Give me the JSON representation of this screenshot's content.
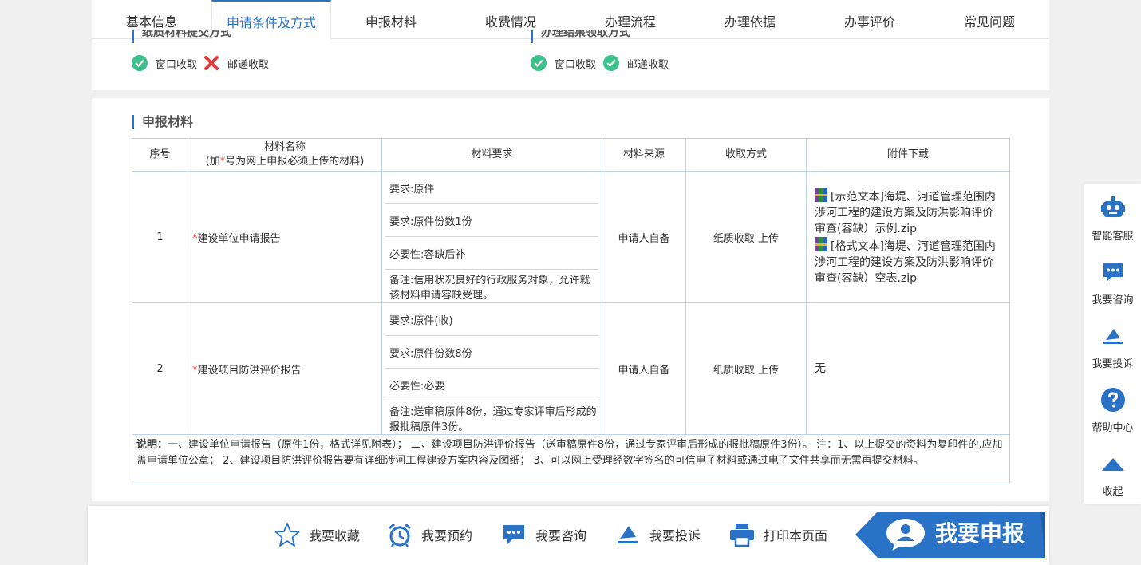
{
  "tabs": [
    "基本信息",
    "申请条件及方式",
    "申报材料",
    "收费情况",
    "办理流程",
    "办理依据",
    "办事评价",
    "常见问题"
  ],
  "active_tab": "申请条件及方式",
  "submit_section": {
    "heading": "纸质材料提交方式",
    "options": [
      {
        "label": "窗口收取",
        "status": "check"
      },
      {
        "label": "邮递收取",
        "status": "cross"
      }
    ]
  },
  "result_section": {
    "heading": "办理结果领取方式",
    "options": [
      {
        "label": "窗口收取",
        "status": "check"
      },
      {
        "label": "邮递收取",
        "status": "check"
      }
    ]
  },
  "materials": {
    "title": "申报材料",
    "headers": {
      "index": "序号",
      "name_line1": "材料名称",
      "name_line2_pre": "(加",
      "name_line2_star": "*",
      "name_line2_post": "号为网上申报必须上传的材料)",
      "requirement": "材料要求",
      "source": "材料来源",
      "method": "收取方式",
      "download": "附件下载"
    },
    "rows": [
      {
        "index": "1",
        "star": "*",
        "name": "建设单位申请报告",
        "requirements": [
          "要求:原件",
          "要求:原件份数1份",
          "必要性:容缺后补",
          "备注:信用状况良好的行政服务对象，允许就该材料申请容缺受理。"
        ],
        "source": "申请人自备",
        "method": "纸质收取 上传",
        "attachments": [
          "[示范文本]海堤、河道管理范围内涉河工程的建设方案及防洪影响评价审查(容缺）示例.zip",
          "[格式文本]海堤、河道管理范围内涉河工程的建设方案及防洪影响评价审查(容缺）空表.zip"
        ]
      },
      {
        "index": "2",
        "star": "*",
        "name": "建设项目防洪评价报告",
        "requirements": [
          "要求:原件(收)",
          "要求:原件份数8份",
          "必要性:必要",
          "备注:送审稿原件8份，通过专家评审后形成的报批稿原件3份。"
        ],
        "source": "申请人自备",
        "method": "纸质收取 上传",
        "no_attachment": "无"
      }
    ],
    "note_label": "说明：",
    "note_text": "一、建设单位申请报告（原件1份，格式详见附表）； 二、建设项目防洪评价报告（送审稿原件8份，通过专家评审后形成的报批稿原件3份）。 注：1、以上提交的资料为复印件的,应加盖申请单位公章； 2、建设项目防洪评价报告要有详细涉河工程建设方案内容及图纸； 3、可以网上受理经数字签名的可信电子材料或通过电子文件共享而无需再提交材料。"
  },
  "right_bar": {
    "items": [
      {
        "label": "智能客服",
        "icon": "robot-icon"
      },
      {
        "label": "我要咨询",
        "icon": "chat-icon"
      },
      {
        "label": "我要投诉",
        "icon": "complaint-icon"
      },
      {
        "label": "帮助中心",
        "icon": "help-icon"
      },
      {
        "label": "收起",
        "icon": "collapse-icon"
      }
    ]
  },
  "bottom_bar": {
    "actions": [
      {
        "label": "我要收藏",
        "icon": "star-icon"
      },
      {
        "label": "我要预约",
        "icon": "alarm-clock-icon"
      },
      {
        "label": "我要咨询",
        "icon": "chat-icon"
      },
      {
        "label": "我要投诉",
        "icon": "complaint-icon"
      },
      {
        "label": "打印本页面",
        "icon": "printer-icon"
      }
    ],
    "apply_label": "我要申报"
  },
  "colors": {
    "accent": "#2a72c6",
    "check": "#3cc08c",
    "cross": "#e23c3c",
    "table_border": "#bcd4ea"
  }
}
